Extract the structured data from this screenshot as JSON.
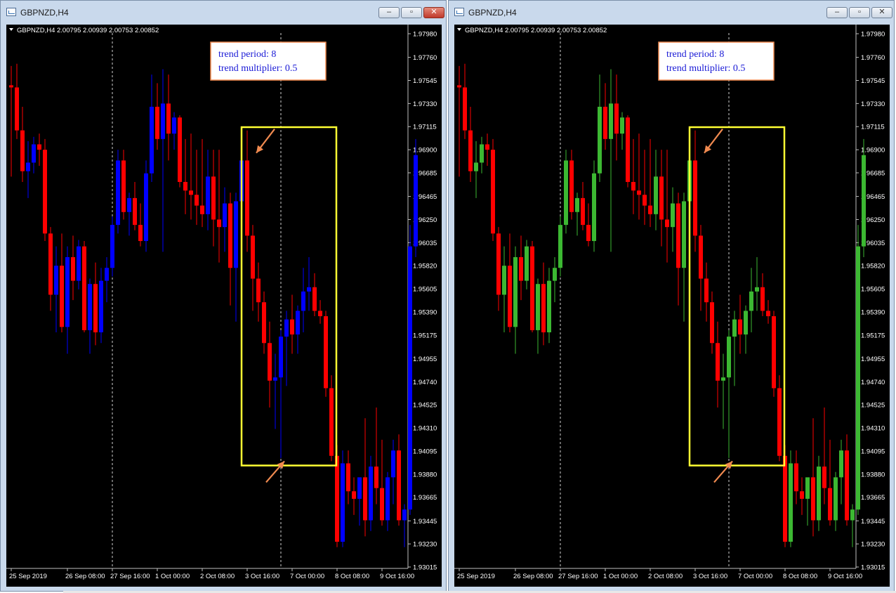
{
  "windows": [
    {
      "title": "GBPNZD,H4",
      "header": "GBPNZD,H4  2.00795 2.00939 2.00753 2.00852",
      "info_box": {
        "line1": "trend period: 8",
        "line2": "trend multiplier: 0.5"
      },
      "colors": {
        "bull": "#0000ff",
        "bear": "#ff0000"
      },
      "controls": {
        "minimize": "–",
        "maximize": "▫",
        "close": "✕"
      }
    },
    {
      "title": "GBPNZD,H4",
      "header": "GBPNZD,H4  2.00795 2.00939 2.00753 2.00852",
      "info_box": {
        "line1": "trend period: 8",
        "line2": "trend multiplier: 0.5"
      },
      "colors": {
        "bull": "#3cb832",
        "bear": "#ff0000"
      },
      "controls": {
        "minimize": "–",
        "maximize": "▫",
        "close": "✕"
      }
    }
  ],
  "chart_data": {
    "type": "candlestick",
    "symbol": "GBPNZD",
    "timeframe": "H4",
    "ylim": [
      1.9295,
      1.9805
    ],
    "y_ticks": [
      "1.97980",
      "1.97760",
      "1.97545",
      "1.97330",
      "1.97115",
      "1.96900",
      "1.96685",
      "1.96465",
      "1.96250",
      "1.96035",
      "1.95820",
      "1.95605",
      "1.95390",
      "1.95175",
      "1.94955",
      "1.94740",
      "1.94525",
      "1.94310",
      "1.94095",
      "1.93880",
      "1.93665",
      "1.93445",
      "1.93230",
      "1.93015"
    ],
    "x_ticks": [
      {
        "label": "25 Sep 2019",
        "index": 0
      },
      {
        "label": "26 Sep 08:00",
        "index": 10
      },
      {
        "label": "27 Sep 16:00",
        "index": 18
      },
      {
        "label": "1 Oct 00:00",
        "index": 26
      },
      {
        "label": "2 Oct 08:00",
        "index": 34
      },
      {
        "label": "3 Oct 16:00",
        "index": 42
      },
      {
        "label": "7 Oct 00:00",
        "index": 50
      },
      {
        "label": "8 Oct 08:00",
        "index": 58
      },
      {
        "label": "9 Oct 16:00",
        "index": 66
      }
    ],
    "period_separators": [
      18,
      48
    ],
    "candles": [
      {
        "o": 1.975,
        "h": 1.9768,
        "l": 1.9665,
        "c": 1.9748
      },
      {
        "o": 1.9748,
        "h": 1.977,
        "l": 1.97,
        "c": 1.9708
      },
      {
        "o": 1.9708,
        "h": 1.973,
        "l": 1.966,
        "c": 1.967
      },
      {
        "o": 1.967,
        "h": 1.9698,
        "l": 1.9645,
        "c": 1.9678
      },
      {
        "o": 1.9678,
        "h": 1.9702,
        "l": 1.9668,
        "c": 1.9695
      },
      {
        "o": 1.9695,
        "h": 1.9705,
        "l": 1.9675,
        "c": 1.969
      },
      {
        "o": 1.969,
        "h": 1.97,
        "l": 1.9605,
        "c": 1.9612
      },
      {
        "o": 1.9612,
        "h": 1.9618,
        "l": 1.954,
        "c": 1.9555
      },
      {
        "o": 1.9555,
        "h": 1.96,
        "l": 1.952,
        "c": 1.9582
      },
      {
        "o": 1.9582,
        "h": 1.9612,
        "l": 1.952,
        "c": 1.9525
      },
      {
        "o": 1.9525,
        "h": 1.96,
        "l": 1.95,
        "c": 1.959
      },
      {
        "o": 1.959,
        "h": 1.961,
        "l": 1.955,
        "c": 1.9568
      },
      {
        "o": 1.9568,
        "h": 1.9606,
        "l": 1.956,
        "c": 1.96
      },
      {
        "o": 1.96,
        "h": 1.9605,
        "l": 1.952,
        "c": 1.9522
      },
      {
        "o": 1.9522,
        "h": 1.957,
        "l": 1.95,
        "c": 1.9565
      },
      {
        "o": 1.9565,
        "h": 1.9585,
        "l": 1.9508,
        "c": 1.952
      },
      {
        "o": 1.952,
        "h": 1.958,
        "l": 1.951,
        "c": 1.9568
      },
      {
        "o": 1.9568,
        "h": 1.959,
        "l": 1.9548,
        "c": 1.958
      },
      {
        "o": 1.958,
        "h": 1.9628,
        "l": 1.9572,
        "c": 1.962
      },
      {
        "o": 1.962,
        "h": 1.969,
        "l": 1.9612,
        "c": 1.968
      },
      {
        "o": 1.968,
        "h": 1.969,
        "l": 1.9625,
        "c": 1.9632
      },
      {
        "o": 1.9632,
        "h": 1.965,
        "l": 1.961,
        "c": 1.9645
      },
      {
        "o": 1.9645,
        "h": 1.966,
        "l": 1.9615,
        "c": 1.962
      },
      {
        "o": 1.962,
        "h": 1.964,
        "l": 1.96,
        "c": 1.9605
      },
      {
        "o": 1.9605,
        "h": 1.968,
        "l": 1.9595,
        "c": 1.9668
      },
      {
        "o": 1.9668,
        "h": 1.976,
        "l": 1.966,
        "c": 1.973
      },
      {
        "o": 1.973,
        "h": 1.9752,
        "l": 1.969,
        "c": 1.97
      },
      {
        "o": 1.97,
        "h": 1.9765,
        "l": 1.9595,
        "c": 1.9733
      },
      {
        "o": 1.9733,
        "h": 1.976,
        "l": 1.968,
        "c": 1.9705
      },
      {
        "o": 1.9705,
        "h": 1.9725,
        "l": 1.969,
        "c": 1.972
      },
      {
        "o": 1.972,
        "h": 1.9722,
        "l": 1.9655,
        "c": 1.966
      },
      {
        "o": 1.966,
        "h": 1.97,
        "l": 1.963,
        "c": 1.9652
      },
      {
        "o": 1.9652,
        "h": 1.9705,
        "l": 1.9625,
        "c": 1.9648
      },
      {
        "o": 1.9648,
        "h": 1.969,
        "l": 1.962,
        "c": 1.9638
      },
      {
        "o": 1.9638,
        "h": 1.97,
        "l": 1.9618,
        "c": 1.963
      },
      {
        "o": 1.963,
        "h": 1.969,
        "l": 1.9615,
        "c": 1.9665
      },
      {
        "o": 1.9665,
        "h": 1.969,
        "l": 1.96,
        "c": 1.9625
      },
      {
        "o": 1.9625,
        "h": 1.969,
        "l": 1.9585,
        "c": 1.9618
      },
      {
        "o": 1.9618,
        "h": 1.9655,
        "l": 1.9595,
        "c": 1.964
      },
      {
        "o": 1.964,
        "h": 1.965,
        "l": 1.9545,
        "c": 1.958
      },
      {
        "o": 1.958,
        "h": 1.965,
        "l": 1.953,
        "c": 1.9642
      },
      {
        "o": 1.9642,
        "h": 1.969,
        "l": 1.96,
        "c": 1.968
      },
      {
        "o": 1.968,
        "h": 1.9708,
        "l": 1.9595,
        "c": 1.961
      },
      {
        "o": 1.961,
        "h": 1.962,
        "l": 1.954,
        "c": 1.957
      },
      {
        "o": 1.957,
        "h": 1.9585,
        "l": 1.953,
        "c": 1.9548
      },
      {
        "o": 1.9548,
        "h": 1.9558,
        "l": 1.95,
        "c": 1.951
      },
      {
        "o": 1.951,
        "h": 1.953,
        "l": 1.945,
        "c": 1.9475
      },
      {
        "o": 1.9475,
        "h": 1.95,
        "l": 1.943,
        "c": 1.9478
      },
      {
        "o": 1.9478,
        "h": 1.9522,
        "l": 1.9403,
        "c": 1.9516
      },
      {
        "o": 1.9516,
        "h": 1.954,
        "l": 1.947,
        "c": 1.9532
      },
      {
        "o": 1.9532,
        "h": 1.9555,
        "l": 1.95,
        "c": 1.9518
      },
      {
        "o": 1.9518,
        "h": 1.9545,
        "l": 1.95,
        "c": 1.954
      },
      {
        "o": 1.954,
        "h": 1.958,
        "l": 1.952,
        "c": 1.9558
      },
      {
        "o": 1.9558,
        "h": 1.959,
        "l": 1.954,
        "c": 1.9562
      },
      {
        "o": 1.9562,
        "h": 1.9575,
        "l": 1.9535,
        "c": 1.954
      },
      {
        "o": 1.954,
        "h": 1.955,
        "l": 1.9528,
        "c": 1.9535
      },
      {
        "o": 1.9535,
        "h": 1.954,
        "l": 1.946,
        "c": 1.9468
      },
      {
        "o": 1.9468,
        "h": 1.948,
        "l": 1.94,
        "c": 1.9405
      },
      {
        "o": 1.9405,
        "h": 1.9415,
        "l": 1.932,
        "c": 1.9325
      },
      {
        "o": 1.9325,
        "h": 1.941,
        "l": 1.932,
        "c": 1.9398
      },
      {
        "o": 1.9398,
        "h": 1.941,
        "l": 1.936,
        "c": 1.9372
      },
      {
        "o": 1.9372,
        "h": 1.9385,
        "l": 1.935,
        "c": 1.9365
      },
      {
        "o": 1.9365,
        "h": 1.938,
        "l": 1.934,
        "c": 1.9385
      },
      {
        "o": 1.9385,
        "h": 1.944,
        "l": 1.933,
        "c": 1.9345
      },
      {
        "o": 1.9345,
        "h": 1.9405,
        "l": 1.9335,
        "c": 1.9395
      },
      {
        "o": 1.9395,
        "h": 1.945,
        "l": 1.936,
        "c": 1.9375
      },
      {
        "o": 1.9375,
        "h": 1.942,
        "l": 1.934,
        "c": 1.9345
      },
      {
        "o": 1.9345,
        "h": 1.939,
        "l": 1.9335,
        "c": 1.9385
      },
      {
        "o": 1.9385,
        "h": 1.942,
        "l": 1.936,
        "c": 1.941
      },
      {
        "o": 1.941,
        "h": 1.9425,
        "l": 1.934,
        "c": 1.9345
      },
      {
        "o": 1.9345,
        "h": 1.936,
        "l": 1.932,
        "c": 1.9355
      },
      {
        "o": 1.9355,
        "h": 1.962,
        "l": 1.935,
        "c": 1.96
      },
      {
        "o": 1.96,
        "h": 1.97,
        "l": 1.959,
        "c": 1.9685
      }
    ],
    "annotations": {
      "highlight_box": {
        "from_index": 42,
        "to_index": 57,
        "price_top": 1.9711,
        "price_bottom": 1.9396,
        "color": "#ffff33"
      },
      "arrows": [
        {
          "direction": "down-left",
          "index": 43,
          "price": 1.9687,
          "color": "#f08a50"
        },
        {
          "direction": "up-right",
          "index": 48,
          "price": 1.94,
          "color": "#f08a50"
        }
      ]
    }
  }
}
